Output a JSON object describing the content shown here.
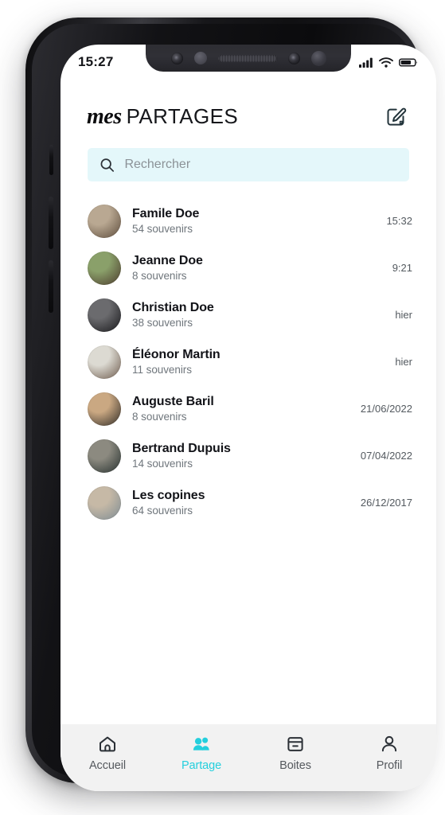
{
  "status_bar": {
    "time": "15:27",
    "icons": [
      "signal-bars-icon",
      "wifi-icon",
      "battery-icon"
    ]
  },
  "header": {
    "logo_primary": "mes",
    "logo_secondary": "PARTAGES",
    "compose_icon": "compose-edit-icon"
  },
  "search": {
    "placeholder": "Rechercher",
    "value": "",
    "icon": "search-icon",
    "background": "#E4F7FA"
  },
  "theme": {
    "accent": "#24CFDD",
    "text_primary": "#121318",
    "text_secondary": "#6F767C",
    "tabbar_background": "#F2F2F2"
  },
  "shares": [
    {
      "name": "Famile Doe",
      "subtitle": "54 souvenirs",
      "time": "15:32",
      "avatar_tone_a": "#b9a892",
      "avatar_tone_b": "#5d4c3c"
    },
    {
      "name": "Jeanne Doe",
      "subtitle": "8 souvenirs",
      "time": "9:21",
      "avatar_tone_a": "#8aa06a",
      "avatar_tone_b": "#4b3a2c"
    },
    {
      "name": "Christian Doe",
      "subtitle": "38 souvenirs",
      "time": "hier",
      "avatar_tone_a": "#6b6b6e",
      "avatar_tone_b": "#17171a"
    },
    {
      "name": "Éléonor Martin",
      "subtitle": "11 souvenirs",
      "time": "hier",
      "avatar_tone_a": "#dcdad2",
      "avatar_tone_b": "#6d5a4c"
    },
    {
      "name": "Auguste Baril",
      "subtitle": "8 souvenirs",
      "time": "21/06/2022",
      "avatar_tone_a": "#caa882",
      "avatar_tone_b": "#2e2a26"
    },
    {
      "name": "Bertrand Dupuis",
      "subtitle": "14 souvenirs",
      "time": "07/04/2022",
      "avatar_tone_a": "#8c8a80",
      "avatar_tone_b": "#26302e"
    },
    {
      "name": "Les copines",
      "subtitle": "64 souvenirs",
      "time": "26/12/2017",
      "avatar_tone_a": "#c6b9a6",
      "avatar_tone_b": "#7d8b93"
    }
  ],
  "tabbar": {
    "items": [
      {
        "label": "Accueil",
        "icon": "home-icon",
        "active": false
      },
      {
        "label": "Partage",
        "icon": "people-icon",
        "active": true
      },
      {
        "label": "Boites",
        "icon": "box-icon",
        "active": false
      },
      {
        "label": "Profil",
        "icon": "person-icon",
        "active": false
      }
    ]
  }
}
